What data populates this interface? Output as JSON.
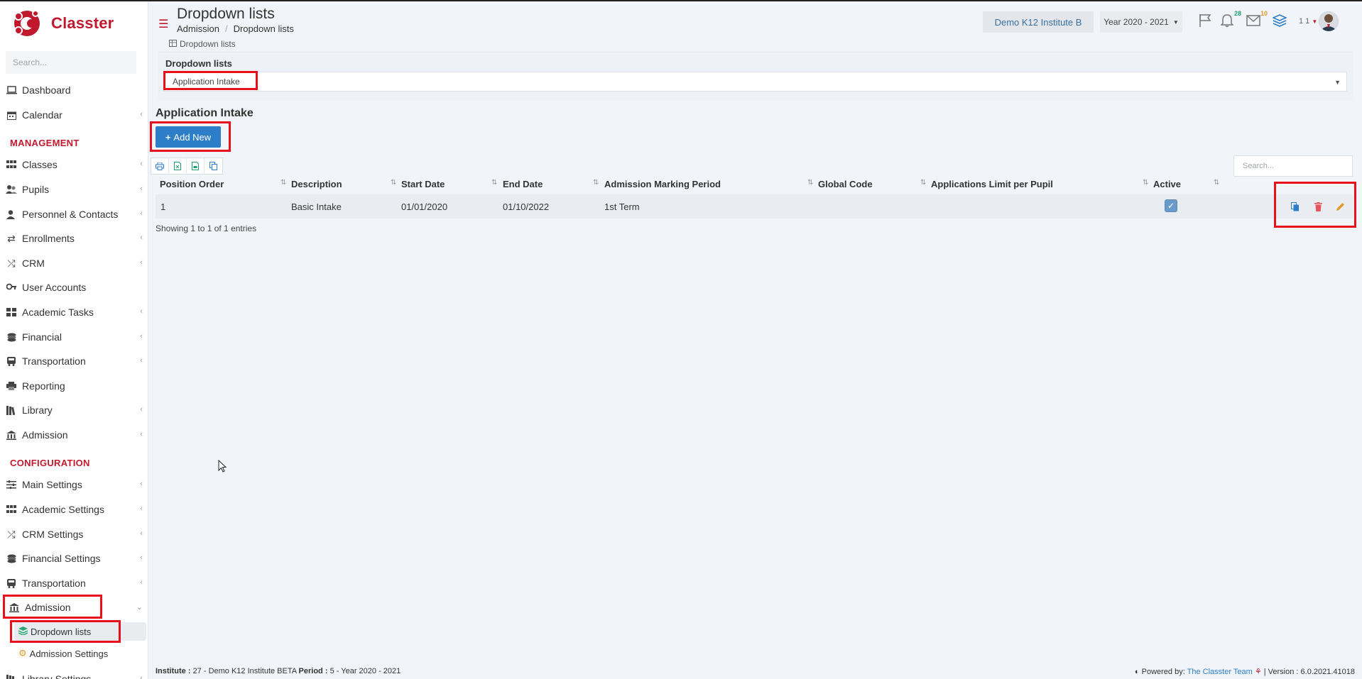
{
  "app": {
    "name": "Classter"
  },
  "sidebar": {
    "search_placeholder": "Search...",
    "items": [
      {
        "label": "Dashboard",
        "icon": "laptop-icon"
      },
      {
        "label": "Calendar",
        "icon": "calendar-icon"
      },
      {
        "label": "Classes",
        "icon": "grid-icon"
      },
      {
        "label": "Pupils",
        "icon": "users-icon"
      },
      {
        "label": "Personnel & Contacts",
        "icon": "person-icon"
      },
      {
        "label": "Enrollments",
        "icon": "exchange-icon"
      },
      {
        "label": "CRM",
        "icon": "shuffle-icon"
      },
      {
        "label": "User Accounts",
        "icon": "key-icon"
      },
      {
        "label": "Academic Tasks",
        "icon": "tiles-icon"
      },
      {
        "label": "Financial",
        "icon": "coins-icon"
      },
      {
        "label": "Transportation",
        "icon": "bus-icon"
      },
      {
        "label": "Reporting",
        "icon": "printer-icon"
      },
      {
        "label": "Library",
        "icon": "books-icon"
      },
      {
        "label": "Admission",
        "icon": "bank-icon"
      }
    ],
    "section_management": "MANAGEMENT",
    "section_configuration": "CONFIGURATION",
    "config_items": [
      {
        "label": "Main Settings",
        "icon": "sliders-icon"
      },
      {
        "label": "Academic Settings",
        "icon": "grid-icon"
      },
      {
        "label": "CRM Settings",
        "icon": "shuffle-icon"
      },
      {
        "label": "Financial Settings",
        "icon": "coins-icon"
      },
      {
        "label": "Transportation",
        "icon": "bus-icon"
      },
      {
        "label": "Admission",
        "icon": "bank-icon"
      }
    ],
    "sub_items": [
      {
        "label": "Dropdown lists",
        "icon": "layers-icon"
      },
      {
        "label": "Admission Settings",
        "icon": "gears-icon"
      }
    ],
    "partial_item": "Library Settings"
  },
  "header": {
    "title": "Dropdown lists",
    "breadcrumb": [
      "Admission",
      "Dropdown lists"
    ],
    "institute": "Demo K12 Institute B",
    "year": "Year 2020 - 2021",
    "notifications_count": "28",
    "messages_count": "10",
    "user_label": "1 1"
  },
  "main": {
    "small_crumb": "Dropdown lists",
    "filter_label": "Dropdown lists",
    "selected_list": "Application Intake",
    "section_title": "Application Intake",
    "add_button": "Add New",
    "search_placeholder": "Search...",
    "columns": [
      "Position Order",
      "Description",
      "Start Date",
      "End Date",
      "Admission Marking Period",
      "Global Code",
      "Applications Limit per Pupil",
      "Active"
    ],
    "rows": [
      {
        "position": "1",
        "description": "Basic Intake",
        "start": "01/01/2020",
        "end": "01/10/2022",
        "period": "1st Term",
        "global_code": "",
        "limit": "",
        "active": true
      }
    ],
    "info": "Showing 1 to 1 of 1 entries"
  },
  "footer": {
    "institute_label": "Institute :",
    "institute_value": "27 - Demo K12 Institute BETA",
    "period_label": "Period :",
    "period_value": "5 - Year 2020 - 2021",
    "powered_by": "Powered by:",
    "team": "The Classter Team",
    "version": "| Version : 6.0.2021.41018"
  },
  "colors": {
    "brand": "#c0192d",
    "accent": "#2c7ec8",
    "highlight": "#e8111b"
  }
}
